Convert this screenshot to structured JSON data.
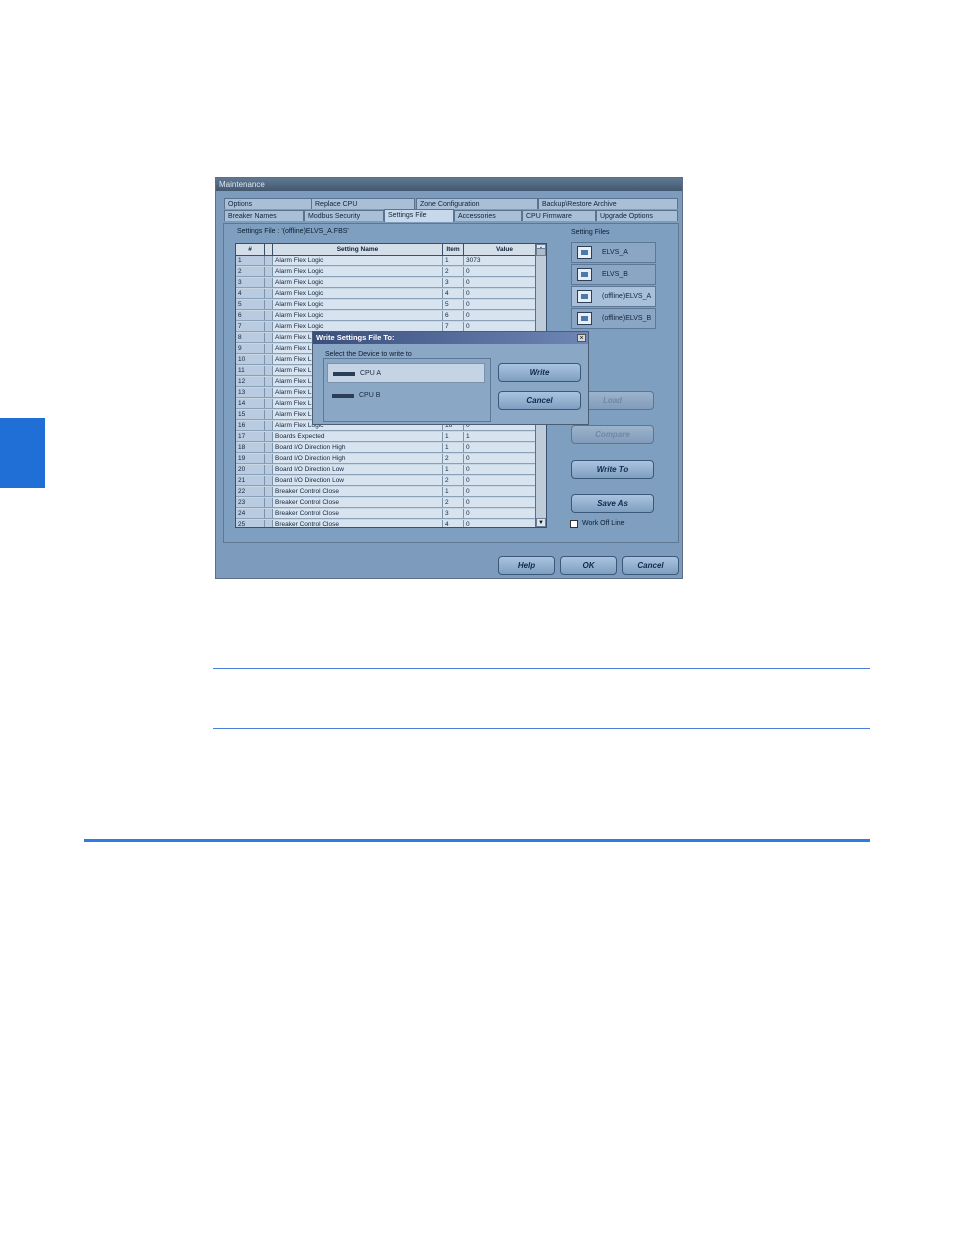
{
  "window": {
    "title": "Maintenance",
    "tabs_row1": [
      "Options",
      "Replace CPU",
      "Zone Configuration",
      "Backup\\Restore Archive"
    ],
    "tabs_row2": [
      "Breaker Names",
      "Modbus Security",
      "Settings File",
      "Accessories",
      "CPU Firmware",
      "Upgrade Options"
    ],
    "active_tab": "Settings File",
    "settings_file_label": "Settings File : '(offline)ELVS_A.FBS'",
    "setting_files_label": "Setting Files",
    "table": {
      "headers": [
        "#",
        "",
        "Setting Name",
        "Item",
        "Value"
      ],
      "rows": [
        [
          "1",
          "Alarm Flex Logic",
          "1",
          "3073"
        ],
        [
          "2",
          "Alarm Flex Logic",
          "2",
          "0"
        ],
        [
          "3",
          "Alarm Flex Logic",
          "3",
          "0"
        ],
        [
          "4",
          "Alarm Flex Logic",
          "4",
          "0"
        ],
        [
          "5",
          "Alarm Flex Logic",
          "5",
          "0"
        ],
        [
          "6",
          "Alarm Flex Logic",
          "6",
          "0"
        ],
        [
          "7",
          "Alarm Flex Logic",
          "7",
          "0"
        ],
        [
          "8",
          "Alarm Flex L",
          "",
          ""
        ],
        [
          "9",
          "Alarm Flex L",
          "",
          ""
        ],
        [
          "10",
          "Alarm Flex L",
          "",
          ""
        ],
        [
          "11",
          "Alarm Flex L",
          "",
          ""
        ],
        [
          "12",
          "Alarm Flex L",
          "",
          ""
        ],
        [
          "13",
          "Alarm Flex L",
          "",
          ""
        ],
        [
          "14",
          "Alarm Flex L",
          "",
          ""
        ],
        [
          "15",
          "Alarm Flex L",
          "",
          ""
        ],
        [
          "16",
          "Alarm Flex Logic",
          "16",
          "0"
        ],
        [
          "17",
          "Boards Expected",
          "1",
          "1"
        ],
        [
          "18",
          "Board I/O Direction High",
          "1",
          "0"
        ],
        [
          "19",
          "Board I/O Direction High",
          "2",
          "0"
        ],
        [
          "20",
          "Board I/O Direction Low",
          "1",
          "0"
        ],
        [
          "21",
          "Board I/O Direction Low",
          "2",
          "0"
        ],
        [
          "22",
          "Breaker Control Close",
          "1",
          "0"
        ],
        [
          "23",
          "Breaker Control Close",
          "2",
          "0"
        ],
        [
          "24",
          "Breaker Control Close",
          "3",
          "0"
        ],
        [
          "25",
          "Breaker Control Close",
          "4",
          "0"
        ]
      ]
    },
    "files": [
      "ELVS_A",
      "ELVS_B",
      "(offline)ELVS_A",
      "(offline)ELVS_B"
    ],
    "buttons": {
      "load": "Load",
      "compare": "Compare",
      "write_to": "Write To",
      "save_as": "Save As",
      "help": "Help",
      "ok": "OK",
      "cancel": "Cancel"
    },
    "work_offline_label": "Work Off Line"
  },
  "dialog": {
    "title": "Write Settings File To:",
    "close": "×",
    "group_label": "Select the Device to write to",
    "devices": [
      "CPU A",
      "CPU B"
    ],
    "write_label": "Write",
    "cancel_label": "Cancel"
  },
  "colors": {
    "accent_rule": "#2f7be0",
    "side_tab": "#1f6fd6"
  }
}
